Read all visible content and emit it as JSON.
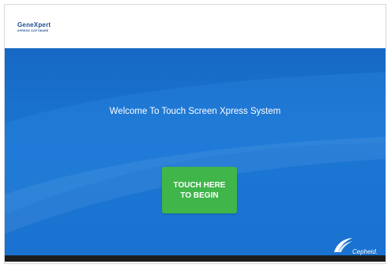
{
  "app": {
    "logo_name": "GeneXpert",
    "logo_subtitle": "XPRESS SOFTWARE"
  },
  "main": {
    "welcome_text": "Welcome To Touch Screen Xpress System"
  },
  "begin_button": {
    "line1": "TOUCH HERE",
    "line2": "TO BEGIN"
  },
  "brand": {
    "name": "Cepheid."
  },
  "colors": {
    "primary_blue": "#1a72cf",
    "button_green": "#3fb54a",
    "footer_dark": "#1d1d1d",
    "logo_blue": "#1f4f8f"
  }
}
